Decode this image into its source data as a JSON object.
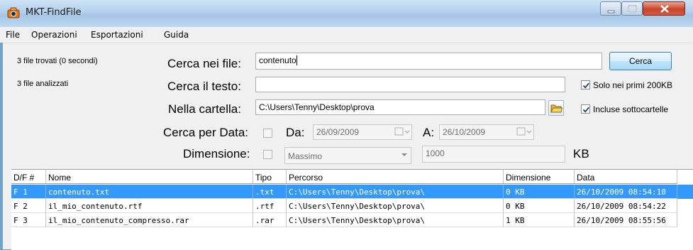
{
  "window": {
    "title": "MKT-FindFile"
  },
  "menu": {
    "items": [
      "File",
      "Operazioni",
      "Esportazioni",
      "Guida"
    ]
  },
  "status": {
    "found": "3 file trovati (0 secondi)",
    "analyzed": "3 file analizzati"
  },
  "search": {
    "content_label": "Cerca nei file:",
    "content_value": "contenuto",
    "search_button": "Cerca",
    "text_label": "Cerca il testo:",
    "text_value": "",
    "folder_label": "Nella cartella:",
    "folder_value": "C:\\Users\\Tenny\\Desktop\\prova",
    "date_label": "Cerca per Data:",
    "date_from_label": "Da:",
    "date_from_value": "26/09/2009",
    "date_to_label": "A:",
    "date_to_value": "26/10/2009",
    "size_label": "Dimensione:",
    "size_mode": "Massimo",
    "size_value": "1000",
    "size_unit": "KB"
  },
  "options": {
    "first_200kb": {
      "label": "Solo nei primi 200KB",
      "checked": true
    },
    "subfolders": {
      "label": "Incluse sottocartelle",
      "checked": true
    },
    "date_enabled": false,
    "size_enabled": false
  },
  "results": {
    "columns": [
      "D/F #",
      "Nome",
      "Tipo",
      "Percorso",
      "Dimensione",
      "Data"
    ],
    "rows": [
      {
        "index": "F 1",
        "name": "contenuto.txt",
        "type": ".txt",
        "path": "C:\\Users\\Tenny\\Desktop\\prova\\",
        "size": "0 KB",
        "date": "26/10/2009 08:54:10",
        "selected": true
      },
      {
        "index": "F 2",
        "name": "il_mio_contenuto.rtf",
        "type": ".rtf",
        "path": "C:\\Users\\Tenny\\Desktop\\prova\\",
        "size": "0 KB",
        "date": "26/10/2009 08:54:22",
        "selected": false
      },
      {
        "index": "F 3",
        "name": "il_mio_contenuto_compresso.rar",
        "type": ".rar",
        "path": "C:\\Users\\Tenny\\Desktop\\prova\\",
        "size": "1 KB",
        "date": "26/10/2009 08:55:56",
        "selected": false
      }
    ]
  },
  "colors": {
    "selection": "#3399ff",
    "titlebar": "#b3d0ec"
  },
  "icons": {
    "app": "camera-icon",
    "folder": "folder-icon",
    "minimize": "minimize-icon",
    "maximize": "maximize-icon",
    "close": "close-icon"
  }
}
